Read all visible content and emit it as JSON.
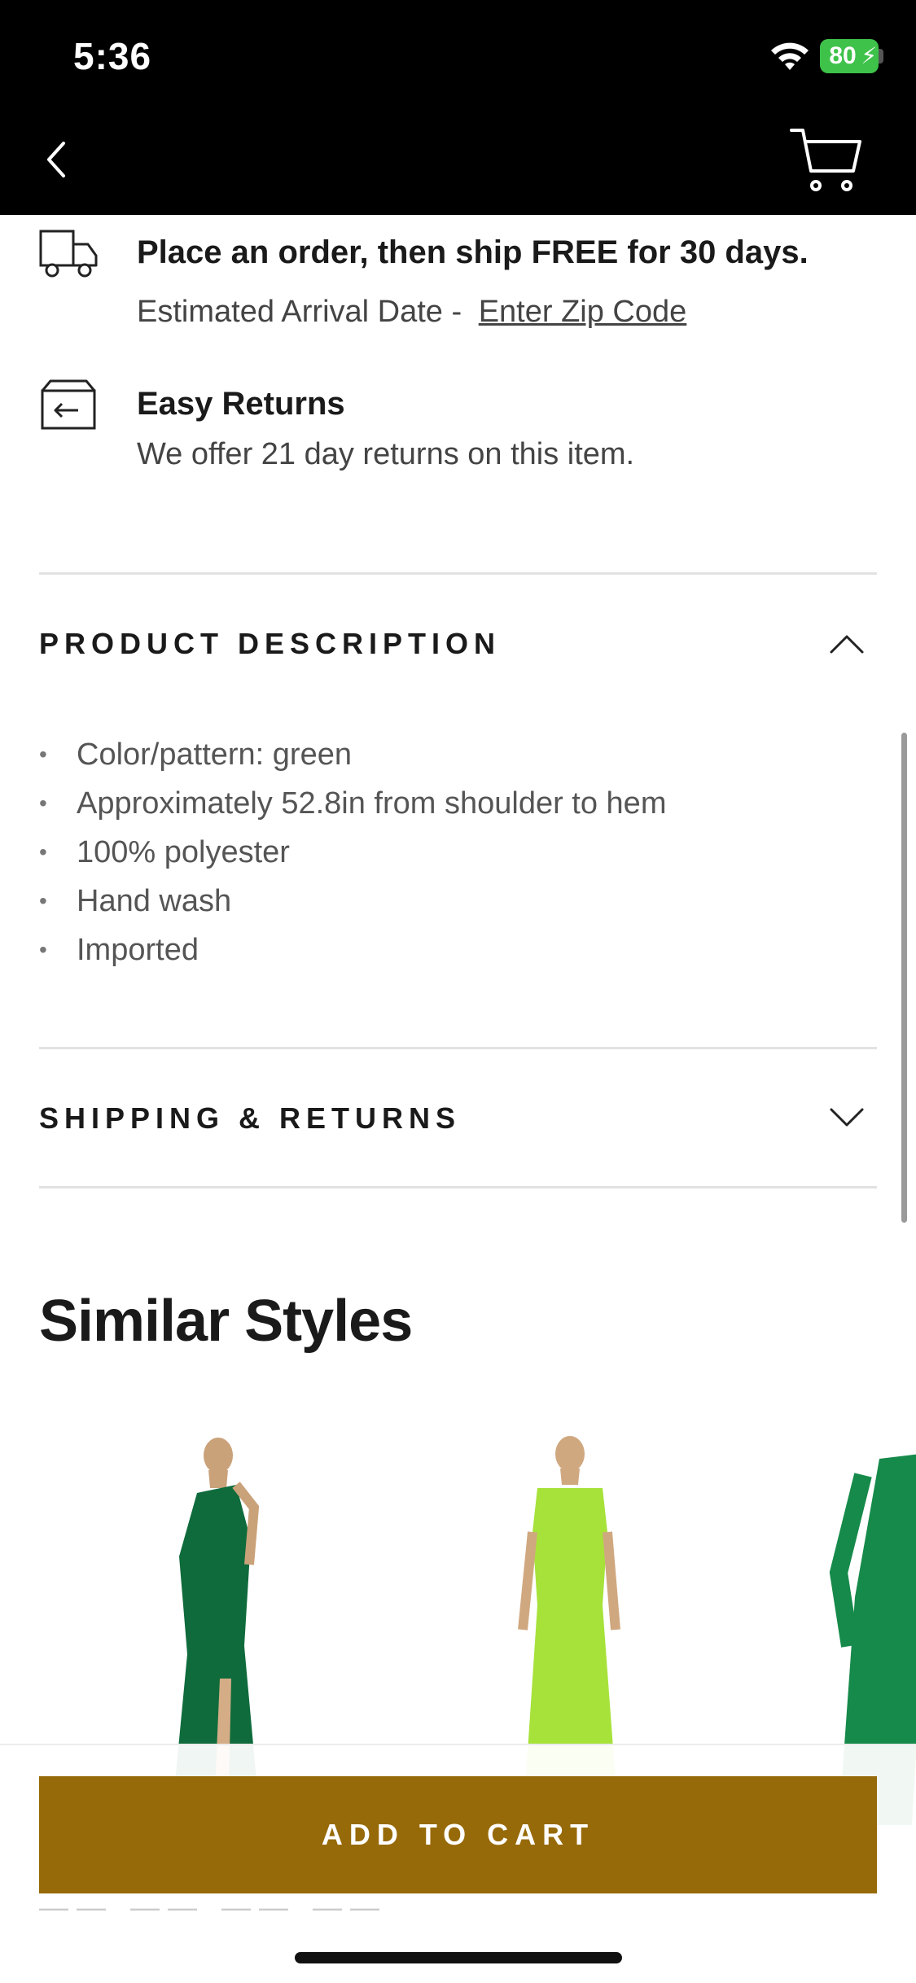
{
  "status_bar": {
    "time": "5:36",
    "battery": "80"
  },
  "shipping": {
    "title": "Place an order, then ship FREE for 30 days.",
    "arrival_label": "Estimated Arrival Date -",
    "zip_link": "Enter Zip Code"
  },
  "returns": {
    "title": "Easy Returns",
    "subtitle": "We offer 21 day returns on this item."
  },
  "product_description": {
    "heading": "PRODUCT DESCRIPTION",
    "items": [
      "Color/pattern: green",
      "Approximately 52.8in from shoulder to hem",
      "100% polyester",
      "Hand wash",
      "Imported"
    ]
  },
  "shipping_returns": {
    "heading": "SHIPPING & RETURNS"
  },
  "similar": {
    "title": "Similar Styles",
    "products": [
      {
        "color": "#0f6b3c"
      },
      {
        "color": "#a6e23a"
      },
      {
        "color": "#168a4a"
      }
    ]
  },
  "cta": {
    "add_to_cart": "ADD TO CART"
  },
  "colors": {
    "accent": "#976a09",
    "header": "#000000",
    "battery": "#3ec24a"
  }
}
